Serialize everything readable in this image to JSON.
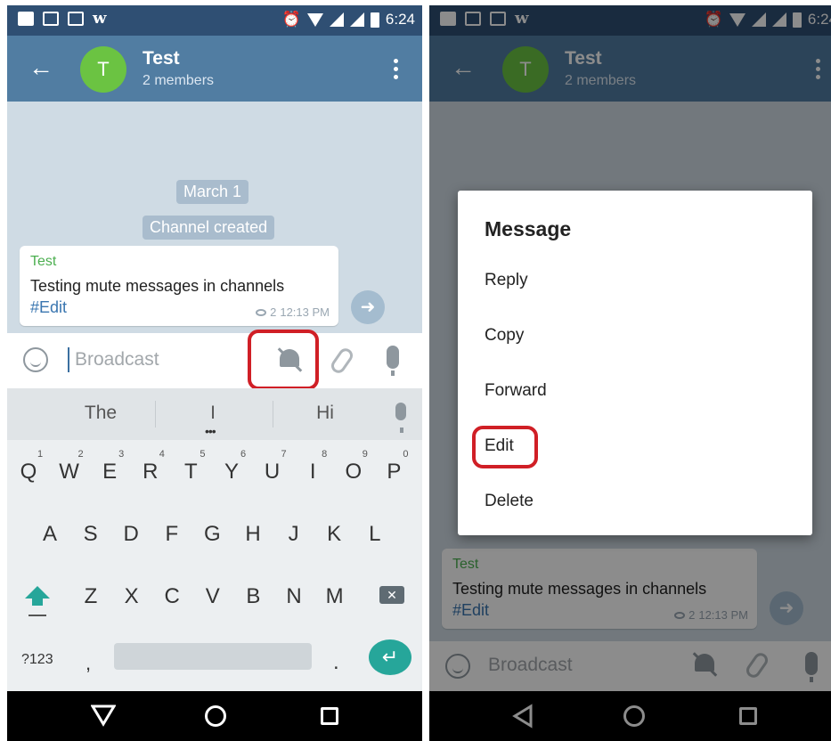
{
  "status_bar": {
    "time": "6:24"
  },
  "chat": {
    "title": "Test",
    "subtitle": "2 members",
    "avatar_letter": "T",
    "date_label": "March 1",
    "service_label": "Channel created"
  },
  "message": {
    "sender": "Test",
    "text": "Testing mute messages in channels",
    "hashtag": "#Edit",
    "views": "2",
    "time": "12:13 PM"
  },
  "input": {
    "placeholder": "Broadcast"
  },
  "keyboard": {
    "suggestions": [
      "The",
      "I",
      "Hi"
    ],
    "row1": [
      "Q",
      "W",
      "E",
      "R",
      "T",
      "Y",
      "U",
      "I",
      "O",
      "P"
    ],
    "row1_hints": [
      "1",
      "2",
      "3",
      "4",
      "5",
      "6",
      "7",
      "8",
      "9",
      "0"
    ],
    "row2": [
      "A",
      "S",
      "D",
      "F",
      "G",
      "H",
      "J",
      "K",
      "L"
    ],
    "row3": [
      "Z",
      "X",
      "C",
      "V",
      "B",
      "N",
      "M"
    ],
    "symbols_key": "?123",
    "comma_key": ",",
    "period_key": "."
  },
  "context_menu": {
    "title": "Message",
    "items": [
      "Reply",
      "Copy",
      "Forward",
      "Edit",
      "Delete"
    ]
  },
  "icons": {
    "back": "back-arrow-icon",
    "more": "more-vertical-icon",
    "emoji": "emoji-icon",
    "mute": "bell-off-icon",
    "attach": "paperclip-icon",
    "mic": "microphone-icon",
    "share": "share-arrow-icon",
    "views": "eye-icon"
  },
  "colors": {
    "status_bar": "#2f4f73",
    "app_bar": "#517da2",
    "avatar": "#6bc342",
    "chat_bg": "#cfdbe4",
    "sender_name": "#4caf50",
    "hashtag": "#3a76b0",
    "highlight_ring": "#d01f26",
    "keyboard_accent": "#26a69a"
  }
}
